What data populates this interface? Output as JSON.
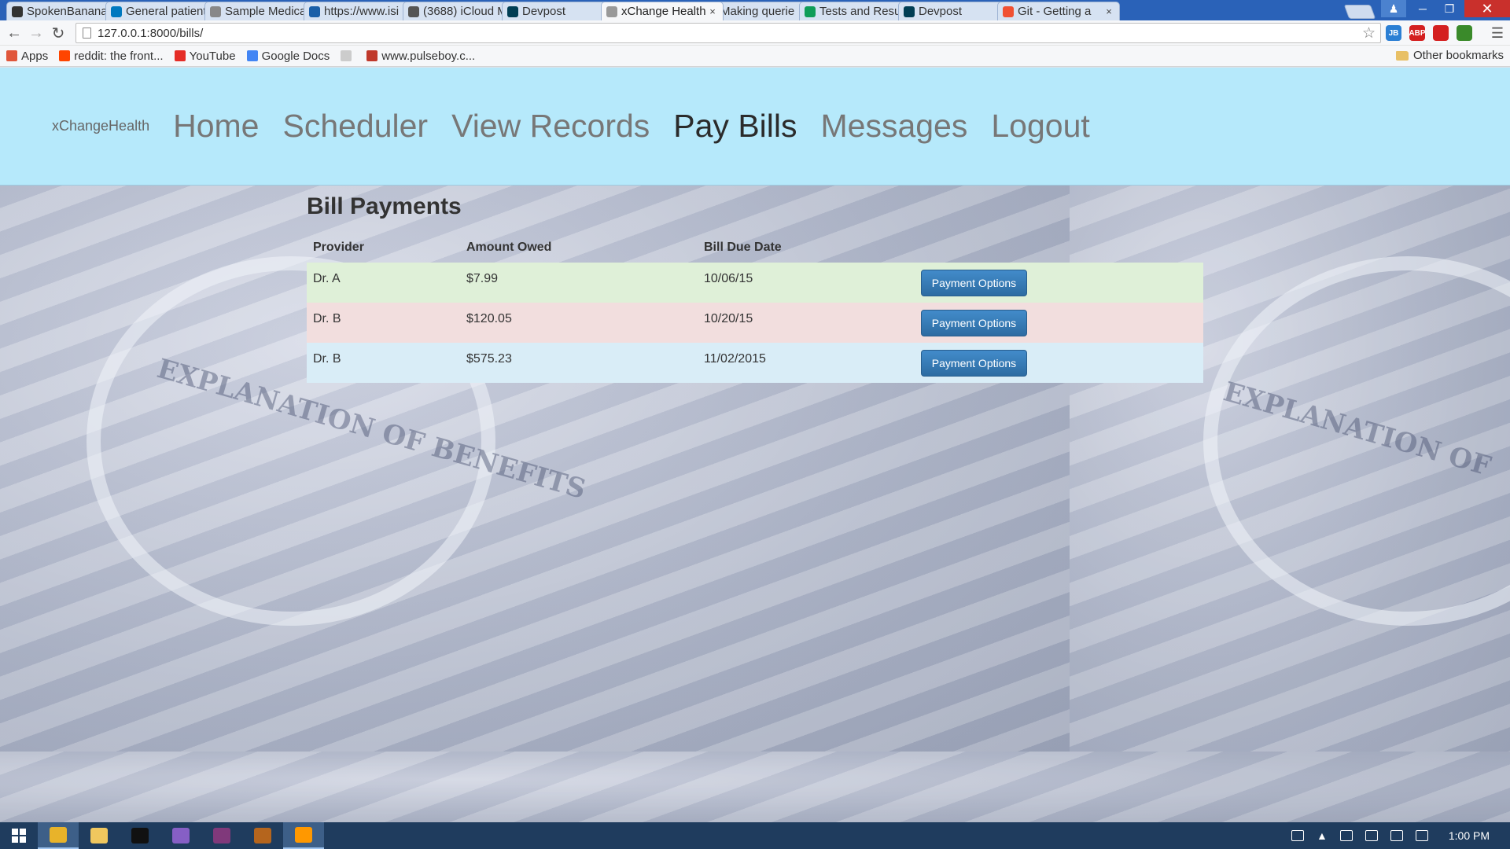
{
  "browser": {
    "tabs": [
      {
        "title": "SpokenBanana",
        "icon": "github-icon",
        "color": "#333333",
        "active": false
      },
      {
        "title": "General patient",
        "icon": "trello-icon",
        "color": "#0079bf",
        "active": false
      },
      {
        "title": "Sample Medica",
        "icon": "document-icon",
        "color": "#888888",
        "active": false
      },
      {
        "title": "https://www.isi",
        "icon": "isi-icon",
        "color": "#1a5fa8",
        "active": false
      },
      {
        "title": "(3688) iCloud M",
        "icon": "apple-icon",
        "color": "#555555",
        "active": false
      },
      {
        "title": "Devpost",
        "icon": "devpost-icon",
        "color": "#003e54",
        "active": false
      },
      {
        "title": "xChange Health",
        "icon": "page-icon",
        "color": "#999999",
        "active": true
      },
      {
        "title": "Making querie",
        "icon": "django-icon",
        "color": "#0c4b33",
        "active": false
      },
      {
        "title": "Tests and Resu",
        "icon": "sheets-icon",
        "color": "#0f9d58",
        "active": false
      },
      {
        "title": "Devpost",
        "icon": "devpost-icon",
        "color": "#003e54",
        "active": false
      },
      {
        "title": "Git - Getting a",
        "icon": "git-icon",
        "color": "#f05032",
        "active": false
      }
    ],
    "url": "127.0.0.1:8000/bills/",
    "bookmarks": [
      {
        "label": "Apps",
        "icon": "apps-grid-icon",
        "color": "#e0563b"
      },
      {
        "label": "reddit: the front...",
        "icon": "reddit-icon",
        "color": "#ff4500"
      },
      {
        "label": "YouTube",
        "icon": "youtube-icon",
        "color": "#e52d27"
      },
      {
        "label": "Google Docs",
        "icon": "docs-icon",
        "color": "#4285f4"
      },
      {
        "label": "",
        "icon": "blank-page-icon",
        "color": "#cccccc"
      },
      {
        "label": "www.pulseboy.c...",
        "icon": "pulseboy-icon",
        "color": "#c0392b"
      }
    ],
    "other_bookmarks": "Other bookmarks",
    "extensions": [
      {
        "label": "JB",
        "icon": "jetbrains-icon",
        "color": "#2b7fd4"
      },
      {
        "label": "ABP",
        "icon": "adblock-icon",
        "color": "#d42020"
      },
      {
        "label": "",
        "icon": "red-square-icon",
        "color": "#d42020"
      },
      {
        "label": "",
        "icon": "shield-check-icon",
        "color": "#3a8a2a"
      }
    ]
  },
  "app": {
    "brand": "xChangeHealth",
    "nav": [
      {
        "label": "Home",
        "active": false
      },
      {
        "label": "Scheduler",
        "active": false
      },
      {
        "label": "View Records",
        "active": false
      },
      {
        "label": "Pay Bills",
        "active": true
      },
      {
        "label": "Messages",
        "active": false
      },
      {
        "label": "Logout",
        "active": false
      }
    ],
    "page_title": "Bill Payments",
    "table": {
      "headers": [
        "Provider",
        "Amount Owed",
        "Bill Due Date",
        ""
      ],
      "rows": [
        {
          "provider": "Dr. A",
          "amount": "$7.99",
          "due": "10/06/15",
          "button": "Payment Options",
          "status": "success"
        },
        {
          "provider": "Dr. B",
          "amount": "$120.05",
          "due": "10/20/15",
          "button": "Payment Options",
          "status": "danger"
        },
        {
          "provider": "Dr. B",
          "amount": "$575.23",
          "due": "11/02/2015",
          "button": "Payment Options",
          "status": "info"
        }
      ]
    }
  },
  "taskbar": {
    "apps": [
      {
        "icon": "chrome-icon",
        "color": "#e8b32a",
        "active": true
      },
      {
        "icon": "file-explorer-icon",
        "color": "#f0c75e",
        "active": false
      },
      {
        "icon": "terminal-icon",
        "color": "#111111",
        "active": false
      },
      {
        "icon": "visual-studio-icon",
        "color": "#865fc5",
        "active": false
      },
      {
        "icon": "onenote-icon",
        "color": "#80397b",
        "active": false
      },
      {
        "icon": "app-icon",
        "color": "#b5651d",
        "active": false
      },
      {
        "icon": "sublime-icon",
        "color": "#ff9800",
        "active": true
      }
    ],
    "clock": "1:00 PM"
  },
  "colors": {
    "nav_bg": "#b6e9fb",
    "primary_button": "#2d6ca2",
    "row_success": "#dff0d8",
    "row_danger": "#f2dede",
    "row_info": "#d9edf7"
  }
}
